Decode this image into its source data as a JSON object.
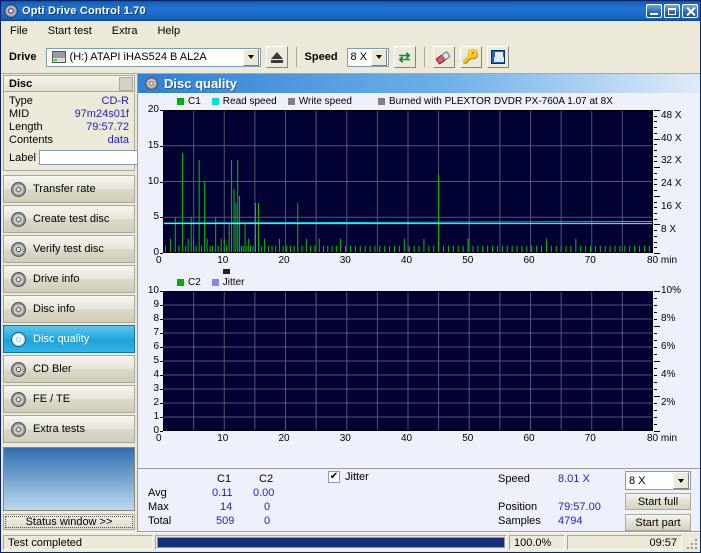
{
  "window": {
    "title": "Opti Drive Control 1.70",
    "icon": "disc-icon",
    "buttons": {
      "minimize": "_",
      "maximize": "□",
      "close": "✕"
    }
  },
  "menu": {
    "items": [
      "File",
      "Start test",
      "Extra",
      "Help"
    ]
  },
  "toolbar": {
    "drive_label": "Drive",
    "drive_value": "(H:)   ATAPI iHAS524   B AL2A",
    "speed_label": "Speed",
    "speed_value": "8 X",
    "refresh_icon": "refresh-icon",
    "eject_icon": "eject-icon",
    "erase_icon": "eraser-icon",
    "key_icon": "key-icon",
    "save_icon": "save-icon"
  },
  "disc": {
    "header": "Disc",
    "rows": [
      {
        "key": "Type",
        "value": "CD-R"
      },
      {
        "key": "MID",
        "value": "97m24s01f"
      },
      {
        "key": "Length",
        "value": "79:57.72"
      },
      {
        "key": "Contents",
        "value": "data"
      }
    ],
    "label_key": "Label",
    "label_value": "",
    "label_placeholder": ""
  },
  "nav": {
    "items": [
      {
        "label": "Transfer rate",
        "selected": false
      },
      {
        "label": "Create test disc",
        "selected": false
      },
      {
        "label": "Verify test disc",
        "selected": false
      },
      {
        "label": "Drive info",
        "selected": false
      },
      {
        "label": "Disc info",
        "selected": false
      },
      {
        "label": "Disc quality",
        "selected": true
      },
      {
        "label": "CD Bler",
        "selected": false
      },
      {
        "label": "FE / TE",
        "selected": false
      },
      {
        "label": "Extra tests",
        "selected": false
      }
    ],
    "status_window_button": "Status window >>"
  },
  "panel": {
    "title": "Disc quality",
    "icon": "disc-quality-icon"
  },
  "chart_data": [
    {
      "type": "line",
      "name": "c1-chart",
      "title": "",
      "xlabel": "min",
      "ylabel": "",
      "xlim": [
        0,
        80
      ],
      "ylim": [
        0,
        20
      ],
      "y2lim": [
        0,
        50
      ],
      "grid": true,
      "legend_position": "top-left",
      "xticks": [
        0,
        10,
        20,
        30,
        40,
        50,
        60,
        70,
        80
      ],
      "xtick_labels": [
        "0",
        "10",
        "20",
        "30",
        "40",
        "50",
        "60",
        "70",
        "80 min"
      ],
      "yticks": [
        0,
        5,
        10,
        15,
        20
      ],
      "ytick_labels": [
        "0",
        "5",
        "10",
        "15",
        "20"
      ],
      "y2ticks": [
        8,
        16,
        24,
        32,
        40,
        48
      ],
      "y2tick_labels": [
        "8 X",
        "16 X",
        "24 X",
        "32 X",
        "40 X",
        "48 X"
      ],
      "legend": [
        {
          "label": "C1",
          "color": "#00b000"
        },
        {
          "label": "Read speed",
          "color": "#00dede"
        },
        {
          "label": "Write speed",
          "color": "#808080"
        }
      ],
      "annotation": {
        "label": "Burned with PLEXTOR DVDR   PX-760A 1.07 at 8X",
        "color": "#808080"
      },
      "series": [
        {
          "name": "C1",
          "color": "#00c800",
          "type": "impulse",
          "x": [
            0.4,
            1.2,
            2.0,
            2.6,
            3.2,
            3.7,
            4.1,
            4.6,
            5.0,
            5.4,
            5.9,
            6.3,
            6.8,
            7.2,
            7.7,
            8.1,
            8.6,
            9.0,
            9.5,
            10.0,
            10.4,
            10.8,
            11.2,
            11.6,
            11.9,
            12.2,
            12.5,
            12.8,
            13.1,
            13.4,
            13.7,
            14.0,
            14.3,
            14.7,
            15.1,
            15.6,
            16.1,
            16.6,
            17.2,
            17.8,
            18.4,
            19.0,
            19.6,
            20.2,
            20.8,
            21.4,
            22.0,
            22.7,
            23.4,
            24.1,
            24.8,
            25.5,
            26.2,
            26.9,
            27.6,
            28.3,
            29.0,
            29.8,
            30.6,
            31.4,
            32.2,
            33.0,
            33.8,
            34.6,
            35.4,
            36.2,
            37.0,
            37.8,
            38.6,
            39.4,
            40.2,
            41.0,
            41.8,
            42.6,
            43.4,
            44.2,
            45.0,
            45.8,
            46.6,
            47.4,
            48.2,
            49.0,
            49.8,
            50.6,
            51.4,
            52.2,
            53.0,
            53.8,
            54.6,
            55.4,
            56.2,
            57.0,
            57.8,
            58.6,
            59.4,
            60.2,
            61.0,
            61.8,
            62.6,
            63.4,
            64.2,
            65.0,
            65.8,
            66.6,
            67.4,
            68.2,
            69.0,
            69.8,
            70.6,
            71.4,
            72.2,
            73.0,
            73.8,
            74.6,
            75.4,
            76.2,
            77.0,
            77.8,
            78.6,
            79.4
          ],
          "y": [
            1,
            2,
            5,
            1,
            14,
            1,
            2,
            5,
            2,
            1,
            13,
            1,
            10,
            2,
            1,
            1,
            5,
            1,
            2,
            2,
            1,
            4,
            13,
            9,
            7,
            13,
            8,
            1,
            1,
            4,
            1,
            2,
            1,
            1,
            7,
            7,
            1,
            2,
            1,
            1,
            1,
            2,
            1,
            1,
            1,
            1,
            7,
            1,
            2,
            1,
            1,
            2,
            1,
            1,
            1,
            1,
            2,
            1,
            1,
            1,
            1,
            1,
            1,
            1,
            1,
            1,
            1,
            1,
            1,
            2,
            1,
            1,
            1,
            2,
            1,
            1,
            11,
            1,
            1,
            1,
            1,
            1,
            2,
            1,
            1,
            1,
            1,
            1,
            1,
            1,
            1,
            1,
            1,
            1,
            1,
            1,
            1,
            1,
            2,
            1,
            1,
            1,
            1,
            1,
            2,
            1,
            1,
            1,
            1,
            1,
            1,
            1,
            1,
            1,
            1,
            1,
            1,
            1,
            1,
            1
          ]
        },
        {
          "name": "Read speed",
          "color": "#00dede",
          "type": "line",
          "value_start": 4.2,
          "value_end": 4.4
        },
        {
          "name": "Write speed",
          "color": "#c8c8dc",
          "type": "line",
          "value": 4.1
        }
      ]
    },
    {
      "type": "line",
      "name": "c2-jitter-chart",
      "title": "",
      "xlabel": "min",
      "ylabel": "",
      "xlim": [
        0,
        80
      ],
      "ylim": [
        0,
        10
      ],
      "y2lim": [
        0,
        10
      ],
      "grid": true,
      "legend_position": "top-left",
      "xticks": [
        0,
        10,
        20,
        30,
        40,
        50,
        60,
        70,
        80
      ],
      "xtick_labels": [
        "0",
        "10",
        "20",
        "30",
        "40",
        "50",
        "60",
        "70",
        "80 min"
      ],
      "yticks": [
        0,
        1,
        2,
        3,
        4,
        5,
        6,
        7,
        8,
        9,
        10
      ],
      "ytick_labels": [
        "0",
        "1",
        "2",
        "3",
        "4",
        "5",
        "6",
        "7",
        "8",
        "9",
        "10"
      ],
      "y2ticks": [
        2,
        4,
        6,
        8,
        10
      ],
      "y2tick_labels": [
        "2%",
        "4%",
        "6%",
        "8%",
        "10%"
      ],
      "legend": [
        {
          "label": "C2",
          "color": "#00b000"
        },
        {
          "label": "Jitter",
          "color": "#8888dd"
        }
      ],
      "series": [
        {
          "name": "C2",
          "color": "#00c800",
          "type": "impulse",
          "x": [],
          "y": []
        },
        {
          "name": "Jitter",
          "color": "#8888dd",
          "type": "line",
          "x": [],
          "y": []
        }
      ]
    }
  ],
  "stats": {
    "columns": [
      "C1",
      "C2"
    ],
    "rows": [
      {
        "label": "Avg",
        "c1": "0.11",
        "c2": "0.00"
      },
      {
        "label": "Max",
        "c1": "14",
        "c2": "0"
      },
      {
        "label": "Total",
        "c1": "509",
        "c2": "0"
      }
    ],
    "jitter_checkbox": {
      "label": "Jitter",
      "checked": true,
      "mark": "✔"
    },
    "speed_label": "Speed",
    "speed_value": "8.01 X",
    "position_label": "Position",
    "position_value": "79:57.00",
    "samples_label": "Samples",
    "samples_value": "4794",
    "speed_select_value": "8 X",
    "start_full_button": "Start full",
    "start_part_button": "Start part"
  },
  "statusbar": {
    "message": "Test completed",
    "progress_percent": 100,
    "progress_label": "100.0%",
    "time": "09:57"
  },
  "colors": {
    "plot_bg": "#000033",
    "grid": "#4a4a6a",
    "c1": "#00c800",
    "read_speed": "#00dede",
    "write_speed": "#c8c8dc",
    "accent": "#2222cc",
    "titlebar": "#1563bd"
  }
}
